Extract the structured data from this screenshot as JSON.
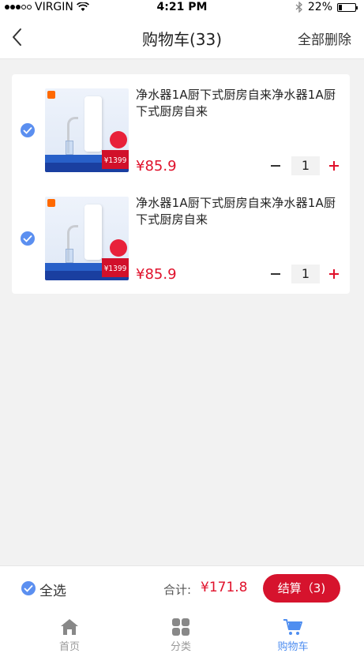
{
  "status_bar": {
    "carrier": "VIRGIN",
    "time": "4:21 PM",
    "battery": "22%",
    "battery_level": 0.22
  },
  "header": {
    "title": "购物车(33)",
    "delete_all": "全部删除"
  },
  "cart": {
    "items": [
      {
        "title": "净水器1A厨下式厨房自来净水器1A厨下式厨房自来",
        "price": "¥85.9",
        "quantity": "1",
        "selected": true,
        "thumb_price": "¥1399"
      },
      {
        "title": "净水器1A厨下式厨房自来净水器1A厨下式厨房自来",
        "price": "¥85.9",
        "quantity": "1",
        "selected": true,
        "thumb_price": "¥1399"
      }
    ]
  },
  "checkout": {
    "select_all": "全选",
    "total_label": "合计:",
    "total_value": "¥171.8",
    "checkout_button": "结算（3)"
  },
  "tabs": [
    {
      "label": "首页",
      "icon": "home-icon",
      "active": false
    },
    {
      "label": "分类",
      "icon": "category-icon",
      "active": false
    },
    {
      "label": "购物车",
      "icon": "cart-icon",
      "active": true
    }
  ],
  "colors": {
    "accent_red": "#e0112b",
    "accent_blue": "#4f8ef0",
    "checkbox_blue": "#5b8ff0",
    "background": "#f2f2f2"
  }
}
